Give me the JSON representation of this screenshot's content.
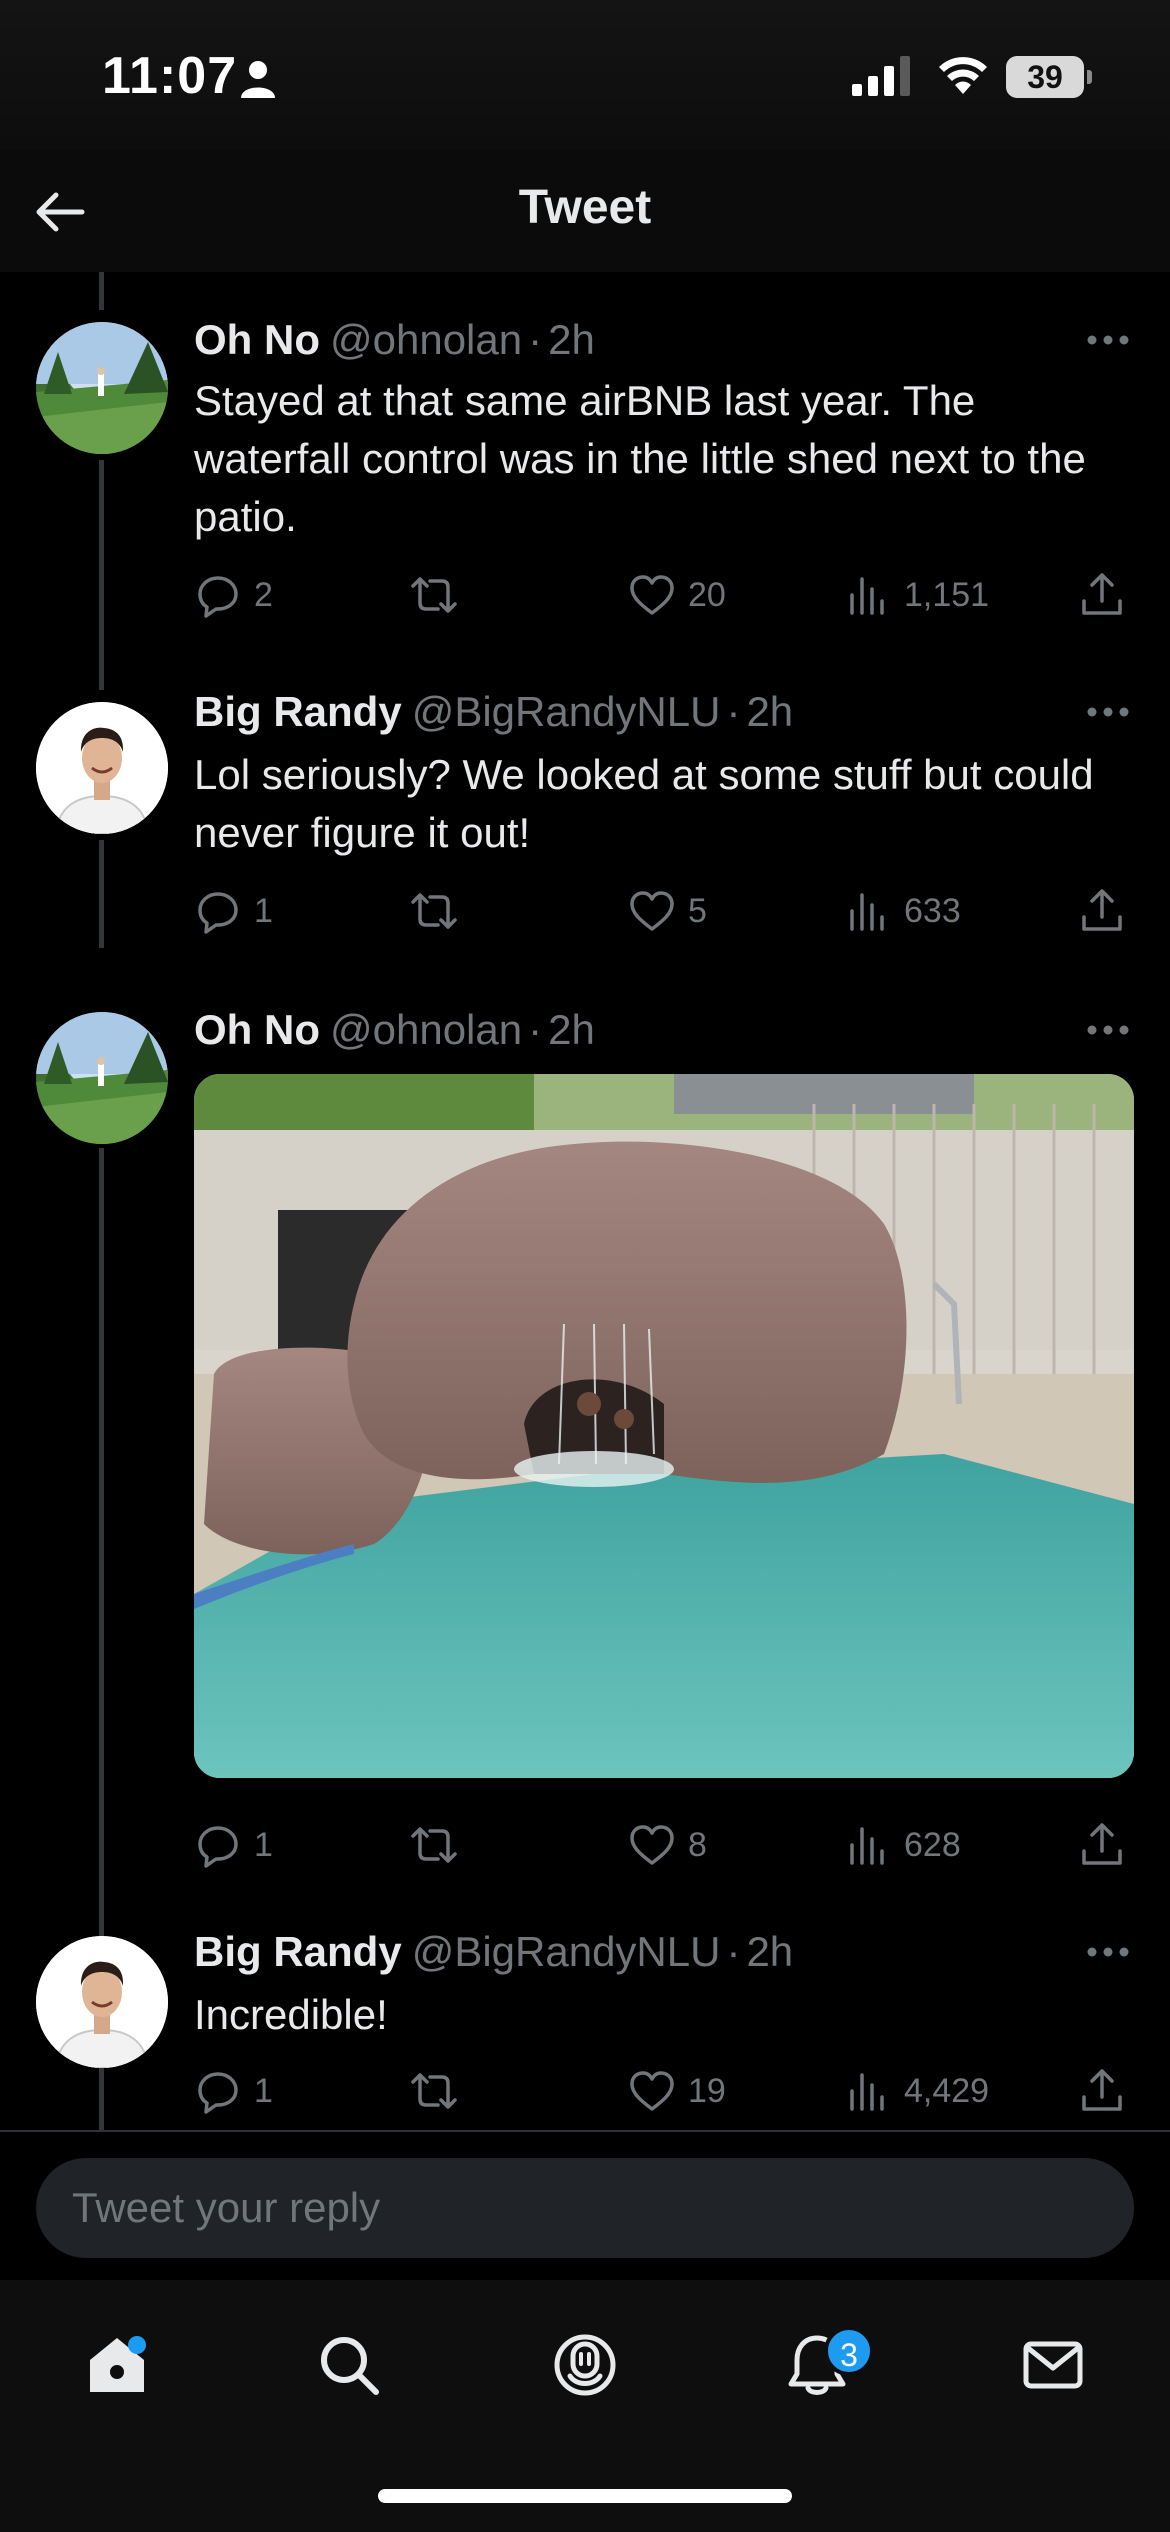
{
  "status_bar": {
    "time": "11:07",
    "battery": "39"
  },
  "header": {
    "title": "Tweet"
  },
  "tweets": [
    {
      "name": "Oh No",
      "handle": "@ohnolan",
      "time": "2h",
      "text": "Stayed at that same airBNB last year. The waterfall control was in the little shed next to the patio.",
      "replies": "2",
      "likes": "20",
      "views": "1,151"
    },
    {
      "name": "Big Randy",
      "handle": "@BigRandyNLU",
      "time": "2h",
      "text": "Lol seriously? We looked at some stuff but could never figure it out!",
      "replies": "1",
      "likes": "5",
      "views": "633"
    },
    {
      "name": "Oh No",
      "handle": "@ohnolan",
      "time": "2h",
      "text": "",
      "replies": "1",
      "likes": "8",
      "views": "628"
    },
    {
      "name": "Big Randy",
      "handle": "@BigRandyNLU",
      "time": "2h",
      "text": "Incredible!",
      "replies": "1",
      "likes": "19",
      "views": "4,429"
    }
  ],
  "reply": {
    "placeholder": "Tweet your reply"
  },
  "tab_bar": {
    "items": [
      "home-icon",
      "search-icon",
      "spaces-icon",
      "bell-icon",
      "mail-icon"
    ],
    "notifications_badge": "3"
  },
  "colors": {
    "accent": "#1d9bf0",
    "muted": "#71767b",
    "text": "#e7e9ea"
  }
}
